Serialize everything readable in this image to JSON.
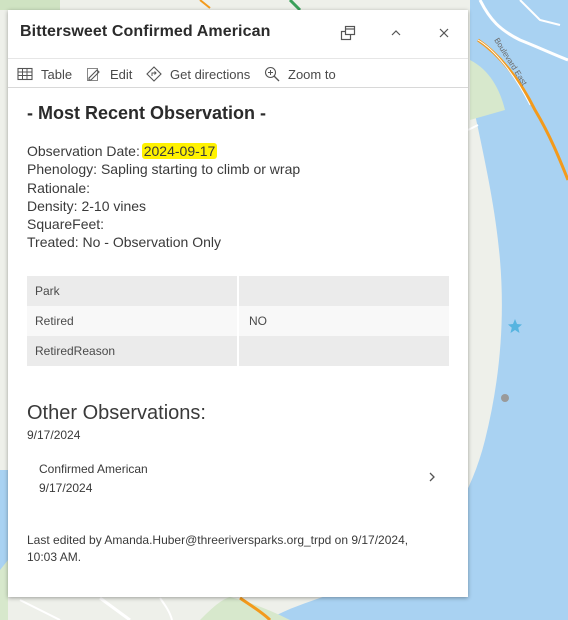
{
  "popup": {
    "title": "Bittersweet Confirmed American",
    "header_buttons": {
      "dock": "dock-icon",
      "collapse": "chevron-up-icon",
      "close": "close-icon"
    }
  },
  "actions": {
    "table": "Table",
    "edit": "Edit",
    "directions": "Get directions",
    "zoom": "Zoom to"
  },
  "observation": {
    "heading": "- Most Recent Observation -",
    "date_label": "Observation Date: ",
    "date_value": "2024-09-17",
    "phenology": "Phenology: Sapling starting to climb or wrap",
    "rationale": "Rationale:",
    "density": "Density: 2-10 vines",
    "square_feet": "SquareFeet:",
    "treated": "Treated: No - Observation Only"
  },
  "attributes": [
    {
      "key": "Park",
      "value": ""
    },
    {
      "key": "Retired",
      "value": "NO"
    },
    {
      "key": "RetiredReason",
      "value": ""
    }
  ],
  "other": {
    "heading": "Other Observations:",
    "date": "9/17/2024",
    "related": {
      "title": "Confirmed American",
      "date": "9/17/2024"
    }
  },
  "last_edited": "Last edited by Amanda.Huber@threeriversparks.org_trpd on 9/17/2024, 10:03 AM.",
  "map": {
    "road_label": "Boulevard East",
    "colors": {
      "water": "#a9d2f2",
      "land": "#eef0ea",
      "road_orange": "#f39a1c",
      "highlight": "#fff200",
      "star": "#56b4e0"
    }
  }
}
